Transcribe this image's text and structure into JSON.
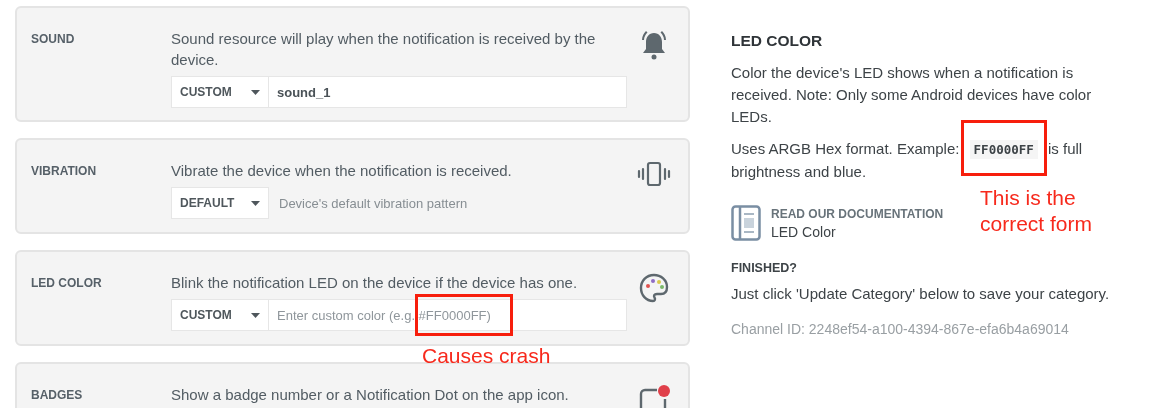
{
  "settings": [
    {
      "kind": "select_input",
      "label": "SOUND",
      "description": "Sound resource will play when the notification is received by the device.",
      "select": "CUSTOM",
      "value": "sound_1"
    },
    {
      "kind": "select_note",
      "label": "VIBRATION",
      "description": "Vibrate the device when the notification is received.",
      "select": "DEFAULT",
      "note": "Device's default vibration pattern"
    },
    {
      "kind": "select_input",
      "label": "LED COLOR",
      "description": "Blink the notification LED on the device if the device has one.",
      "select": "CUSTOM",
      "placeholder": "Enter custom color (e.g. #FF0000FF)"
    },
    {
      "kind": "text_only",
      "label": "BADGES",
      "description": "Show a badge number or a Notification Dot on the app icon."
    }
  ],
  "help": {
    "title": "LED COLOR",
    "paragraph": "Color the device's LED shows when a notification is received. Note: Only some Android devices have color LEDs.",
    "format_before": "Uses ARGB Hex format. Example:",
    "format_code": "FF0000FF",
    "format_after": "is full brightness and blue.",
    "doc_label": "READ OUR DOCUMENTATION",
    "doc_link": "LED Color",
    "finished_title": "FINISHED?",
    "finished_text": "Just click 'Update Category' below to save your category.",
    "channel_id": "Channel ID: 2248ef54-a100-4394-867e-efa6b4a69014"
  },
  "annotations": [
    {
      "text": "Causes crash"
    },
    {
      "text": "This is the correct form"
    }
  ]
}
